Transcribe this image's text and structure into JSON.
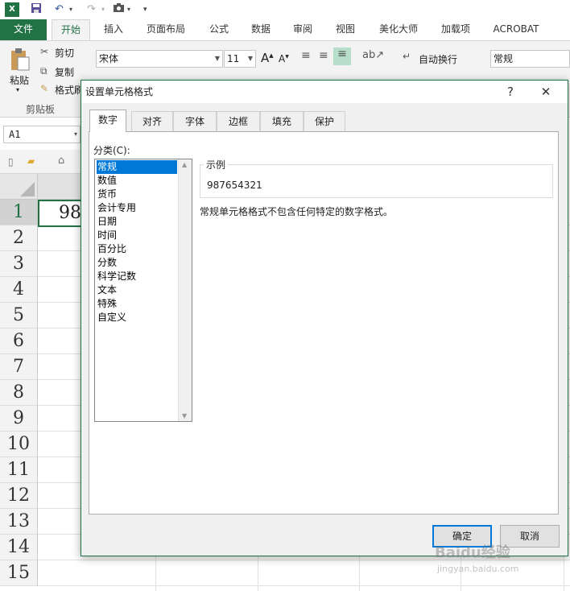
{
  "qat": {
    "undo": "↶",
    "redo": "↷",
    "more": "▾"
  },
  "tabs": [
    "文件",
    "开始",
    "插入",
    "页面布局",
    "公式",
    "数据",
    "审阅",
    "视图",
    "美化大师",
    "加载项",
    "ACROBAT"
  ],
  "ribbon": {
    "paste": "粘贴",
    "cut": "剪切",
    "copy": "复制",
    "format_painter": "格式刷",
    "clipboard_group": "剪贴板",
    "font_name": "宋体",
    "font_size": "11",
    "wrap_text": "自动换行",
    "number_format": "常规"
  },
  "namebox": "A1",
  "sheet": {
    "rows": [
      "1",
      "2",
      "3",
      "4",
      "5",
      "6",
      "7",
      "8",
      "9",
      "10",
      "11",
      "12",
      "13",
      "14",
      "15"
    ],
    "a1_value": "98"
  },
  "dialog": {
    "title": "设置单元格格式",
    "help": "?",
    "close": "✕",
    "tabs": [
      "数字",
      "对齐",
      "字体",
      "边框",
      "填充",
      "保护"
    ],
    "category_label": "分类(C):",
    "categories": [
      "常规",
      "数值",
      "货币",
      "会计专用",
      "日期",
      "时间",
      "百分比",
      "分数",
      "科学记数",
      "文本",
      "特殊",
      "自定义"
    ],
    "selected_category": "常规",
    "sample_label": "示例",
    "sample_value": "987654321",
    "description": "常规单元格格式不包含任何特定的数字格式。",
    "ok": "确定",
    "cancel": "取消"
  },
  "watermark": {
    "line1": "Baidu经验",
    "line2": "jingyan.baidu.com"
  },
  "colors": {
    "excel_green": "#217346",
    "select_blue": "#0078d7"
  }
}
